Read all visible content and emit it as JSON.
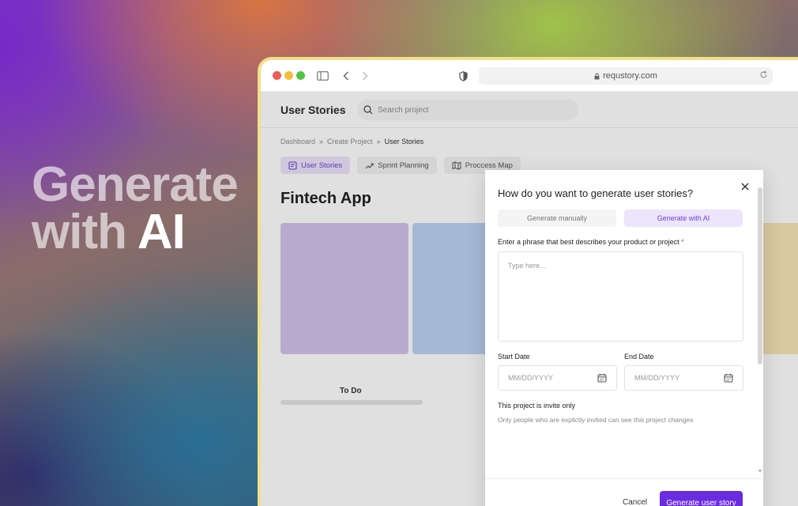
{
  "hero": {
    "line1": "Generate",
    "line2_prefix": "with ",
    "line2_strong": "AI"
  },
  "browser": {
    "url": "requstory.com",
    "icons": [
      "sidebar-icon",
      "back-chevron-icon",
      "forward-chevron-icon",
      "shield-icon",
      "lock-icon",
      "reload-icon"
    ]
  },
  "app": {
    "title": "User Stories",
    "search_placeholder": "Search project",
    "breadcrumb": [
      "Dashboard",
      "Create Project",
      "User Stories"
    ],
    "breadcrumb_separator": "»",
    "tabs": [
      {
        "label": "User Stories",
        "icon": "user-stories-icon",
        "active": true
      },
      {
        "label": "Sprint Planning",
        "icon": "sprint-icon",
        "active": false
      },
      {
        "label": "Proccess Map",
        "icon": "map-icon",
        "active": false
      }
    ],
    "page_title": "Fintech App",
    "column_label": "To Do",
    "card_colors": [
      "#d3c3ec",
      "#bcd3f5",
      "#f6e5b8"
    ]
  },
  "dialog": {
    "title": "How do you want to generate user stories?",
    "options": [
      {
        "label": "Generate manually",
        "active": false
      },
      {
        "label": "Generate with AI",
        "active": true
      }
    ],
    "phrase_label": "Enter a phrase that best describes your product or project",
    "required_mark": "*",
    "phrase_placeholder": "Type here...",
    "start_date_label": "Start Date",
    "end_date_label": "End Date",
    "date_placeholder": "MM/DD/YYYY",
    "invite_title": "This project is invite only",
    "invite_desc": "Only people who are explictly invited can see this project changes",
    "cancel_label": "Cancel",
    "submit_label": "Generate user story",
    "accent_color": "#6a2ce0"
  }
}
